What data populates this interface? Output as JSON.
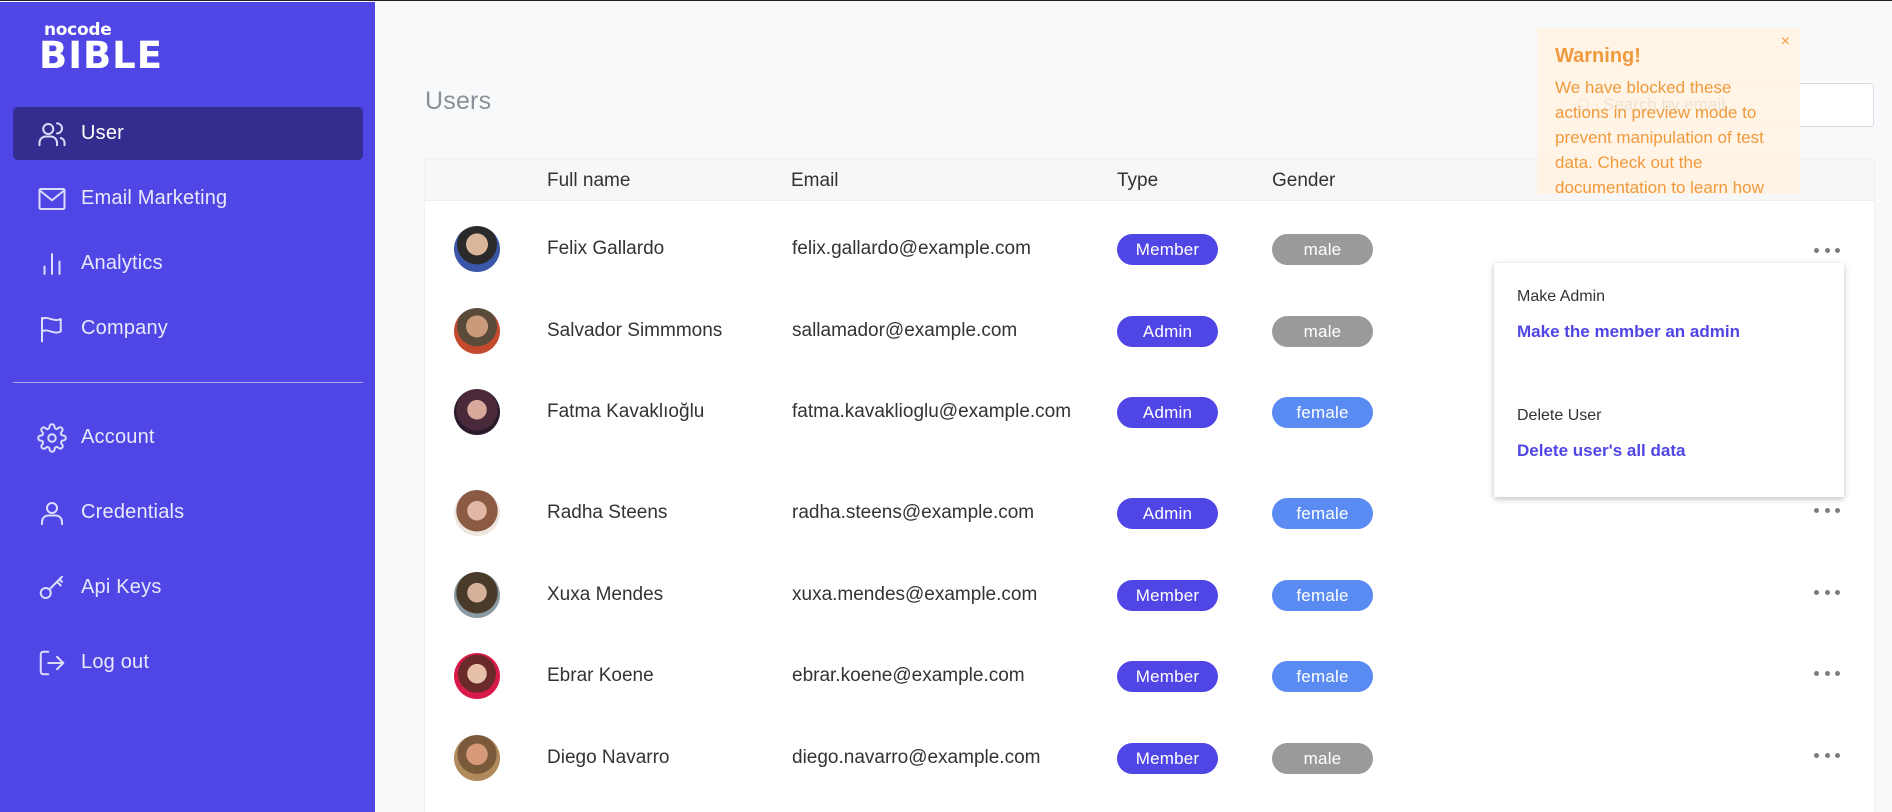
{
  "sidebar": {
    "logo_small": "nocode",
    "logo_big": "BIBLE",
    "items": [
      {
        "label": "User",
        "icon": "users-icon"
      },
      {
        "label": "Email Marketing",
        "icon": "mail-icon"
      },
      {
        "label": "Analytics",
        "icon": "bar-chart-icon"
      },
      {
        "label": "Company",
        "icon": "flag-icon"
      },
      {
        "label": "Account",
        "icon": "gear-icon"
      },
      {
        "label": "Credentials",
        "icon": "user-icon"
      },
      {
        "label": "Api Keys",
        "icon": "key-icon"
      },
      {
        "label": "Log out",
        "icon": "logout-icon"
      }
    ],
    "active_color": "#332d8f",
    "bg_color": "#4f46e5"
  },
  "main": {
    "title": "Users",
    "search": {
      "placeholder": "Search by email"
    },
    "columns": [
      "Full name",
      "Email",
      "Type",
      "Gender"
    ],
    "rows": [
      {
        "name": "Felix Gallardo",
        "email": "felix.gallardo@example.com",
        "type": "Member",
        "gender": "male"
      },
      {
        "name": "Salvador Simmmons",
        "email": "sallamador@example.com",
        "type": "Admin",
        "gender": "male"
      },
      {
        "name": "Fatma Kavaklıoğlu",
        "email": "fatma.kavaklioglu@example.com",
        "type": "Admin",
        "gender": "female"
      },
      {
        "name": "Radha Steens",
        "email": "radha.steens@example.com",
        "type": "Admin",
        "gender": "female"
      },
      {
        "name": "Xuxa Mendes",
        "email": "xuxa.mendes@example.com",
        "type": "Member",
        "gender": "female"
      },
      {
        "name": "Ebrar Koene",
        "email": "ebrar.koene@example.com",
        "type": "Member",
        "gender": "female"
      },
      {
        "name": "Diego Navarro",
        "email": "diego.navarro@example.com",
        "type": "Member",
        "gender": "male"
      }
    ]
  },
  "dropdown": {
    "section1_heading": "Make Admin",
    "section1_link": "Make the member an admin",
    "section2_heading": "Delete User",
    "section2_link": "Delete user's all data"
  },
  "toast": {
    "title": "Warning!",
    "close": "×",
    "body": "We have blocked these actions in preview mode to prevent manipulation of test data. Check out the documentation to learn how"
  }
}
